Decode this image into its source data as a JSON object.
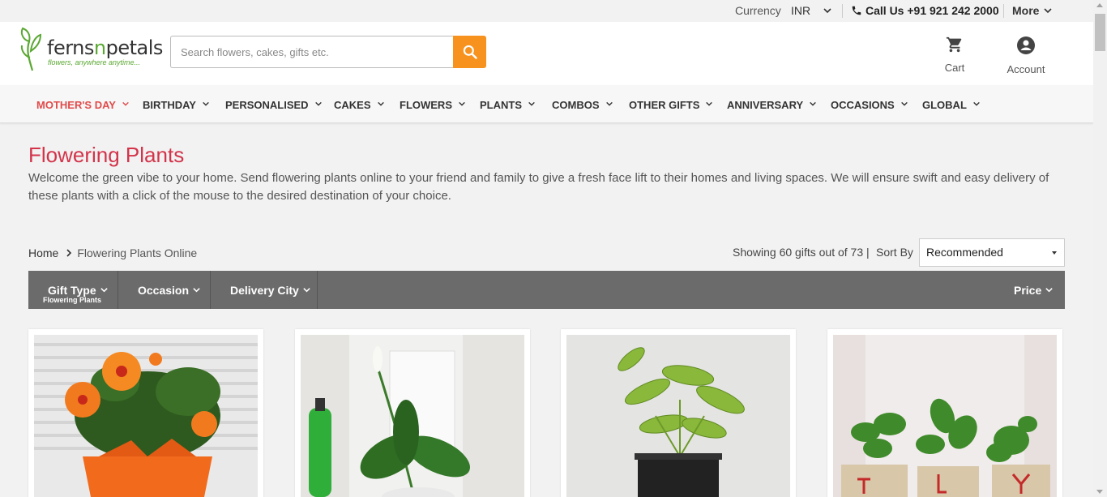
{
  "topbar": {
    "currency_label": "Currency",
    "currency_value": "INR",
    "call_text": "Call Us +91 921 242 2000",
    "more_label": "More"
  },
  "header": {
    "logo_word_a": "ferns",
    "logo_word_n": "n",
    "logo_word_b": "petals",
    "logo_tagline": "flowers, anywhere anytime...",
    "search_placeholder": "Search flowers, cakes, gifts etc.",
    "cart_label": "Cart",
    "account_label": "Account"
  },
  "nav": {
    "items": [
      {
        "label": "MOTHER'S DAY"
      },
      {
        "label": "BIRTHDAY"
      },
      {
        "label": "PERSONALISED"
      },
      {
        "label": "CAKES"
      },
      {
        "label": "FLOWERS"
      },
      {
        "label": "PLANTS"
      },
      {
        "label": "COMBOS"
      },
      {
        "label": "OTHER GIFTS"
      },
      {
        "label": "ANNIVERSARY"
      },
      {
        "label": "OCCASIONS"
      },
      {
        "label": "GLOBAL"
      }
    ]
  },
  "intro": {
    "title": "Flowering Plants",
    "description": "Welcome the green vibe to your home. Send flowering plants online to your friend and family to give a fresh face lift to their homes and living spaces. We will ensure swift and easy delivery of these plants with a click of the mouse to the desired destination of your choice."
  },
  "breadcrumb": {
    "home": "Home",
    "current": "Flowering Plants Online"
  },
  "listing": {
    "showing_text": "Showing 60 gifts out of 73 |",
    "sort_label": "Sort By",
    "sort_value": "Recommended"
  },
  "filters": {
    "gift_type": "Gift Type",
    "gift_type_selected": "Flowering Plants",
    "occasion": "Occasion",
    "delivery_city": "Delivery City",
    "price": "Price"
  },
  "colors": {
    "accent_orange": "#f7921e",
    "title_red": "#d3344a",
    "active_nav": "#e14a4a",
    "filter_bar": "#6b6b6b",
    "brand_green": "#5aa832"
  }
}
